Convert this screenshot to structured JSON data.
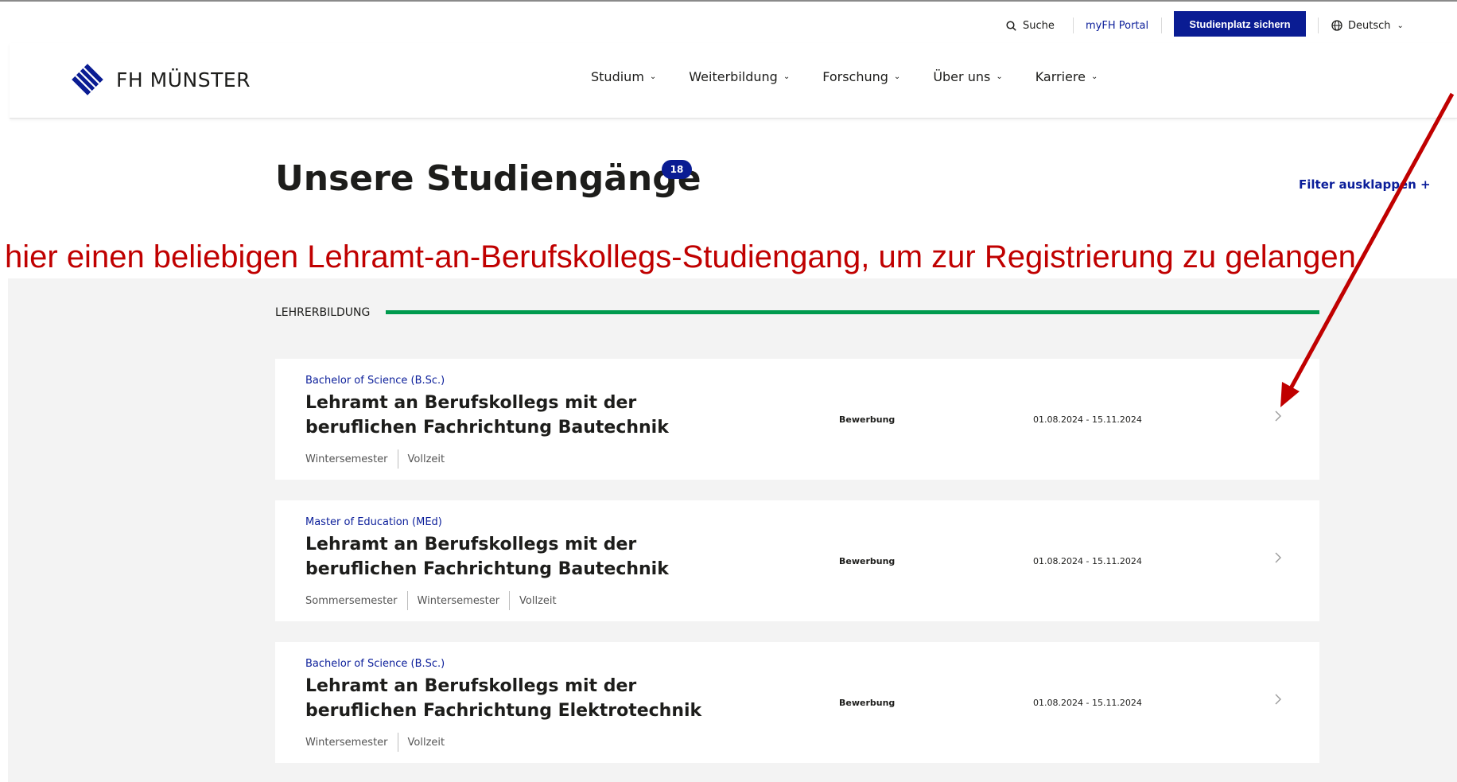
{
  "utility": {
    "search_label": "Suche",
    "portal_label": "myFH Portal",
    "cta_label": "Studienplatz sichern",
    "language_label": "Deutsch"
  },
  "logo": {
    "text": "FH MÜNSTER"
  },
  "nav": {
    "items": [
      {
        "label": "Studium"
      },
      {
        "label": "Weiterbildung"
      },
      {
        "label": "Forschung"
      },
      {
        "label": "Über uns"
      },
      {
        "label": "Karriere"
      }
    ]
  },
  "page": {
    "title": "Unsere Studiengänge",
    "count": "18",
    "filter_label": "Filter ausklappen +"
  },
  "annotation": {
    "text": "hier einen beliebigen Lehramt-an-Berufskollegs-Studiengang, um zur Registrierung zu gelangen",
    "color": "#c00000"
  },
  "section": {
    "label": "LEHRERBILDUNG",
    "accent_color": "#009a4e"
  },
  "programs": [
    {
      "degree": "Bachelor of Science (B.Sc.)",
      "title": "Lehramt an Berufskollegs mit der beruflichen Fachrichtung Bautechnik",
      "tags": [
        "Wintersemester",
        "Vollzeit"
      ],
      "status": "Bewerbung",
      "dates": "01.08.2024 - 15.11.2024"
    },
    {
      "degree": "Master of Education (MEd)",
      "title": "Lehramt an Berufskollegs mit der beruflichen Fachrichtung Bautechnik",
      "tags": [
        "Sommersemester",
        "Wintersemester",
        "Vollzeit"
      ],
      "status": "Bewerbung",
      "dates": "01.08.2024 - 15.11.2024"
    },
    {
      "degree": "Bachelor of Science (B.Sc.)",
      "title": "Lehramt an Berufskollegs mit der beruflichen Fachrichtung Elektrotechnik",
      "tags": [
        "Wintersemester",
        "Vollzeit"
      ],
      "status": "Bewerbung",
      "dates": "01.08.2024 - 15.11.2024"
    }
  ],
  "colors": {
    "brand_blue": "#0a1c93",
    "text": "#1d1d1b",
    "list_background": "#f3f3f3"
  },
  "icons": {
    "search": "search-icon",
    "globe": "globe-icon",
    "chevron_down": "chevron-down-icon",
    "chevron_right": "chevron-right-icon",
    "logo": "fh-logo-icon"
  }
}
